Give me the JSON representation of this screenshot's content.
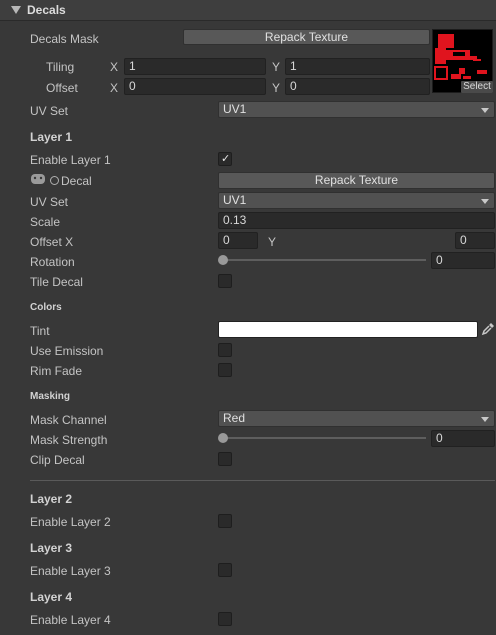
{
  "header": {
    "title": "Decals"
  },
  "decals_mask": {
    "label": "Decals Mask",
    "repack_label": "Repack Texture",
    "tiling_label": "Tiling",
    "offset_label": "Offset",
    "x_label": "X",
    "y_label": "Y",
    "tiling_x": "1",
    "tiling_y": "1",
    "offset_x": "0",
    "offset_y": "0",
    "select_label": "Select"
  },
  "uv_set_top": {
    "label": "UV Set",
    "value": "UV1"
  },
  "layer1": {
    "title": "Layer 1",
    "enable_label": "Enable Layer 1",
    "enable_checked": true,
    "decal_label": "Decal",
    "repack_label": "Repack Texture",
    "uv_set_label": "UV Set",
    "uv_set_value": "UV1",
    "scale_label": "Scale",
    "scale_value": "0.13",
    "offset_x_label": "Offset X",
    "offset_x_value": "0",
    "offset_y_label": "Y",
    "offset_y_value": "0",
    "rotation_label": "Rotation",
    "rotation_value": "0",
    "rotation_fraction": 0,
    "tile_label": "Tile Decal",
    "tile_checked": false,
    "colors_title": "Colors",
    "tint_label": "Tint",
    "tint_color": "#ffffff",
    "use_emission_label": "Use Emission",
    "rim_fade_label": "Rim Fade",
    "masking_title": "Masking",
    "mask_channel_label": "Mask Channel",
    "mask_channel_value": "Red",
    "mask_strength_label": "Mask Strength",
    "mask_strength_value": "0",
    "mask_strength_fraction": 0,
    "clip_label": "Clip Decal"
  },
  "layer2": {
    "title": "Layer 2",
    "enable_label": "Enable Layer 2"
  },
  "layer3": {
    "title": "Layer 3",
    "enable_label": "Enable Layer 3"
  },
  "layer4": {
    "title": "Layer 4",
    "enable_label": "Enable Layer 4"
  },
  "colors": {
    "background": "#383838",
    "texture_red": "#e0141e"
  },
  "icons": [
    "foldout-arrow-icon",
    "texture-thumbnail-icon",
    "gamepad-icon",
    "object-picker-icon",
    "eyedropper-icon",
    "checkmark-icon",
    "dropdown-arrow-icon"
  ]
}
